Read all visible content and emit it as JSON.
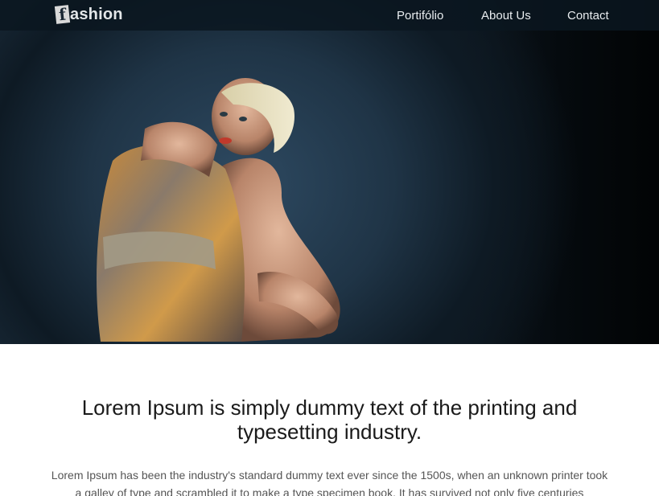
{
  "navbar": {
    "logo_letter": "f",
    "logo_text": "ashion",
    "items": [
      {
        "label": "Portifólio"
      },
      {
        "label": "About Us"
      },
      {
        "label": "Contact"
      }
    ]
  },
  "hero": {
    "image": "fashion model seated hugging knees, patterned gold silk dress, dark teal backdrop"
  },
  "content": {
    "headline": "Lorem Ipsum is simply dummy text of the printing and typesetting industry.",
    "body": "Lorem Ipsum has been the industry's standard dummy text ever since the 1500s, when an unknown printer took a galley of type and scrambled it to make a type specimen book. It has survived not only five centuries"
  },
  "colors": {
    "nav_bg": "#0a1620",
    "hero_bg": "#1f3446",
    "headline": "#1a1a1a",
    "body_text": "#555555"
  }
}
